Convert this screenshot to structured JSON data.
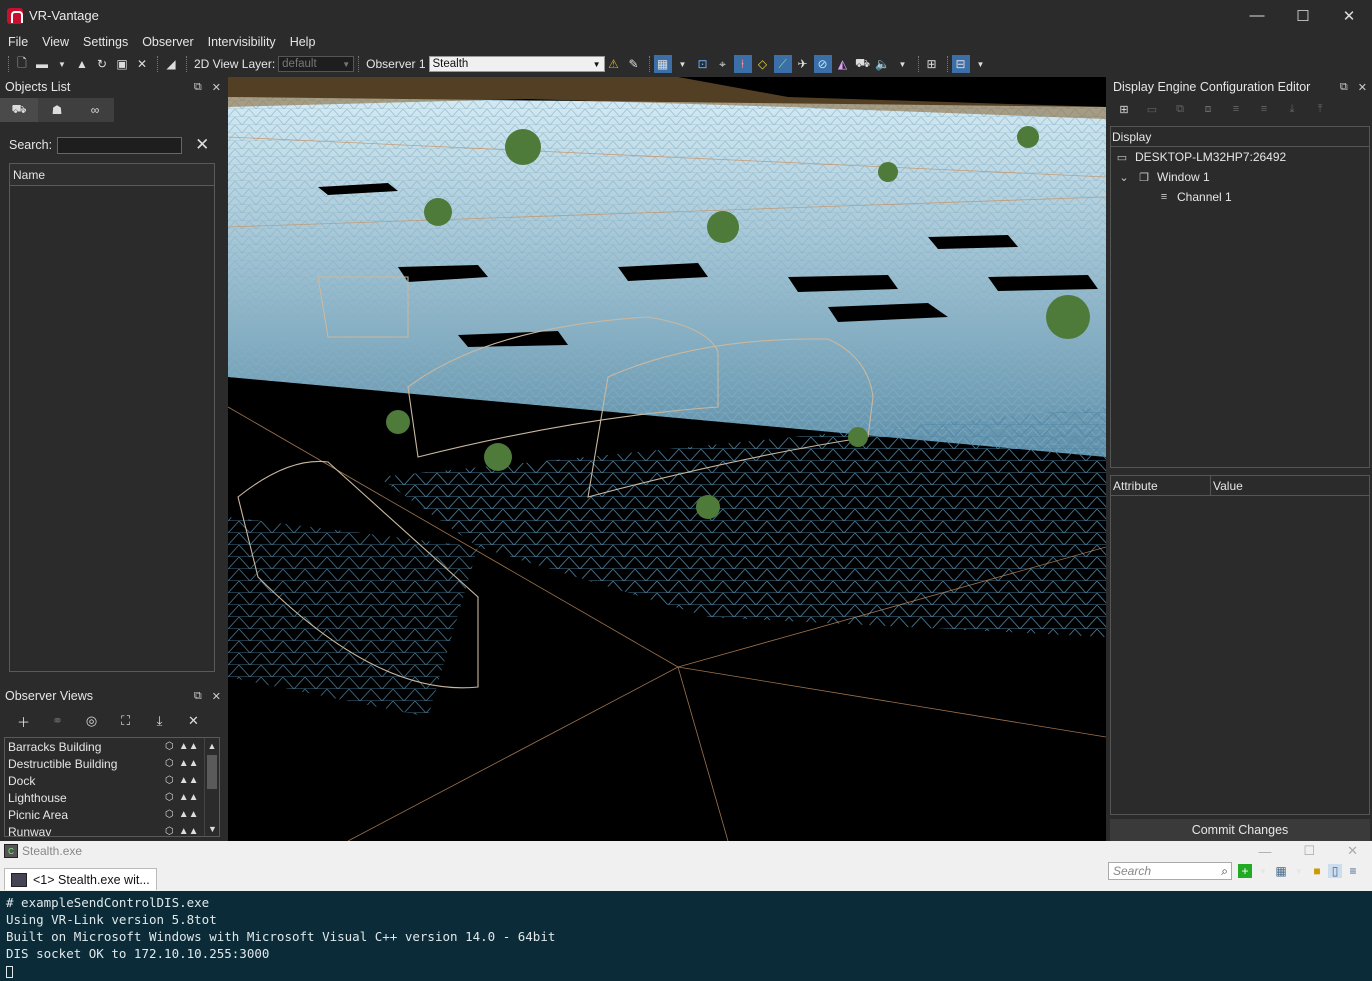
{
  "window": {
    "title": "VR-Vantage",
    "minimize": "—",
    "maximize": "☐",
    "close": "✕"
  },
  "menu": [
    "File",
    "View",
    "Settings",
    "Observer",
    "Intervisibility",
    "Help"
  ],
  "toolbar": {
    "view_layer_label": "2D View Layer:",
    "view_layer_value": "default",
    "observer_label": "Observer 1",
    "observer_value": "Stealth"
  },
  "objects_panel": {
    "title": "Objects List",
    "search_label": "Search:",
    "search_value": "",
    "column_name": "Name"
  },
  "observer_views": {
    "title": "Observer Views",
    "items": [
      "Barracks Building",
      "Destructible Building",
      "Dock",
      "Lighthouse",
      "Picnic Area",
      "Runway"
    ]
  },
  "display_engine": {
    "title": "Display Engine Configuration Editor",
    "tree_header": "Display",
    "host": "DESKTOP-LM32HP7:26492",
    "window": "Window 1",
    "channel": "Channel 1",
    "attr_col": "Attribute",
    "value_col": "Value",
    "commit_label": "Commit Changes"
  },
  "console": {
    "title": "Stealth.exe",
    "tab_label": "<1> Stealth.exe wit...",
    "search_placeholder": "Search",
    "lines": [
      "# exampleSendControlDIS.exe",
      "Using VR-Link version 5.8tot",
      "Built on Microsoft Windows with Microsoft Visual C++ version 14.0 - 64bit",
      "DIS socket OK to 172.10.10.255:3000"
    ]
  }
}
